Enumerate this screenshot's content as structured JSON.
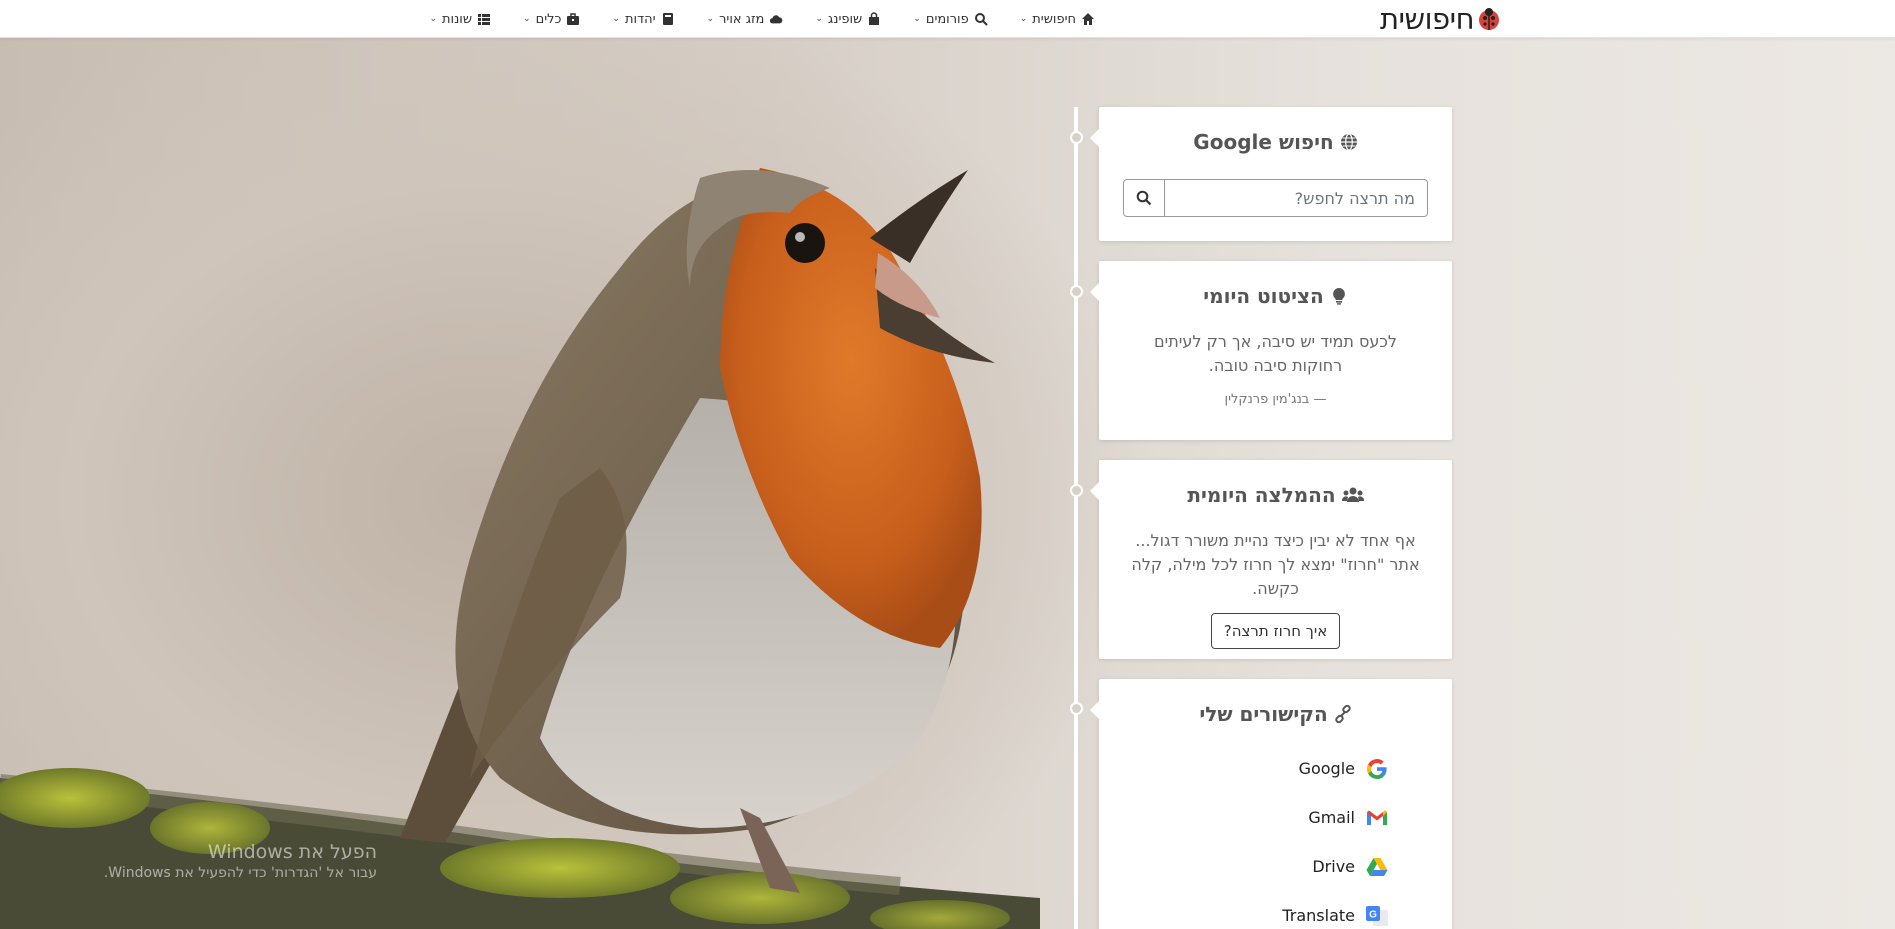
{
  "brand": {
    "name": "חיפושית",
    "logo_icon": "ladybug-icon"
  },
  "menu": [
    {
      "label": "חיפושית",
      "icon": "home-icon"
    },
    {
      "label": "פורומים",
      "icon": "search-icon"
    },
    {
      "label": "שופינג",
      "icon": "shopping-bag-icon"
    },
    {
      "label": "מזג אויר",
      "icon": "cloud-icon"
    },
    {
      "label": "יהדות",
      "icon": "book-icon"
    },
    {
      "label": "כלים",
      "icon": "briefcase-icon"
    },
    {
      "label": "שונות",
      "icon": "list-icon"
    }
  ],
  "search_card": {
    "title": "חיפוש Google",
    "icon": "globe-icon",
    "placeholder": "מה תרצה לחפש?",
    "value": "",
    "button_icon": "search-icon"
  },
  "quote_card": {
    "title": "הציטוט היומי",
    "icon": "lightbulb-icon",
    "text": "לכעס תמיד יש סיבה, אך רק לעיתים רחוקות סיבה טובה.",
    "author": "— בנג'מין פרנקלין"
  },
  "recommendation_card": {
    "title": "ההמלצה היומית",
    "icon": "users-icon",
    "text": "אף אחד לא יבין כיצד נהיית משורר דגול... אתר \"חרוז\" ימצא לך חרוז לכל מילה, קלה כקשה.",
    "button_label": "איך חרוז תרצה?"
  },
  "links_card": {
    "title": "הקישורים שלי",
    "icon": "link-icon",
    "links": [
      {
        "label": "Google",
        "icon": "google-icon"
      },
      {
        "label": "Gmail",
        "icon": "gmail-icon"
      },
      {
        "label": "Drive",
        "icon": "drive-icon"
      },
      {
        "label": "Translate",
        "icon": "translate-icon"
      }
    ]
  },
  "watermark": {
    "line1": "הפעל את Windows",
    "line2": "עבור אל 'הגדרות' כדי להפעיל את Windows."
  },
  "colors": {
    "robin_orange": "#d2651e",
    "card_bg": "#ffffff",
    "timeline": "#ffffff"
  }
}
